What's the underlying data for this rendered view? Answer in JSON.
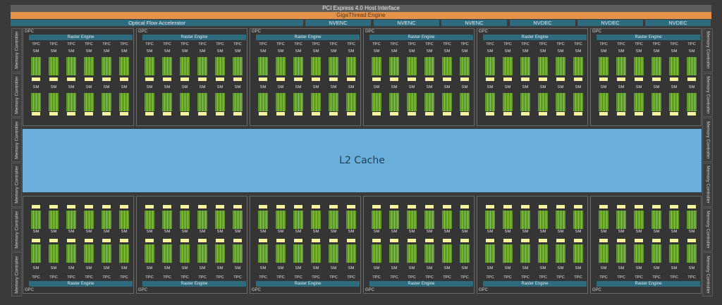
{
  "pcie_label": "PCI Express 4.0 Host Interface",
  "gigathread_label": "GigaThread Engine",
  "ofa_label": "Optical Flow Accelerator",
  "nvenc_labels": [
    "NVENC",
    "NVENC",
    "NVENC"
  ],
  "nvdec_labels": [
    "NVDEC",
    "NVDEC",
    "NVDEC"
  ],
  "memory_controller_label": "Memory Controller",
  "l2_label": "L2 Cache",
  "gpc_label": "GPC",
  "raster_label": "Raster Engine",
  "tpc_label": "TPC",
  "sm_label": "SM",
  "gpc_count_per_row": 6,
  "gpc_rows": 2,
  "tpc_per_gpc": 6,
  "colors": {
    "background": "#3a3a3a",
    "gigathread": "#e6934a",
    "accelerator_blue": "#2f6b7f",
    "l2_cache": "#6aaedc",
    "sm_green": "#8cc63f",
    "sm_yellow": "#f3f3a0"
  }
}
